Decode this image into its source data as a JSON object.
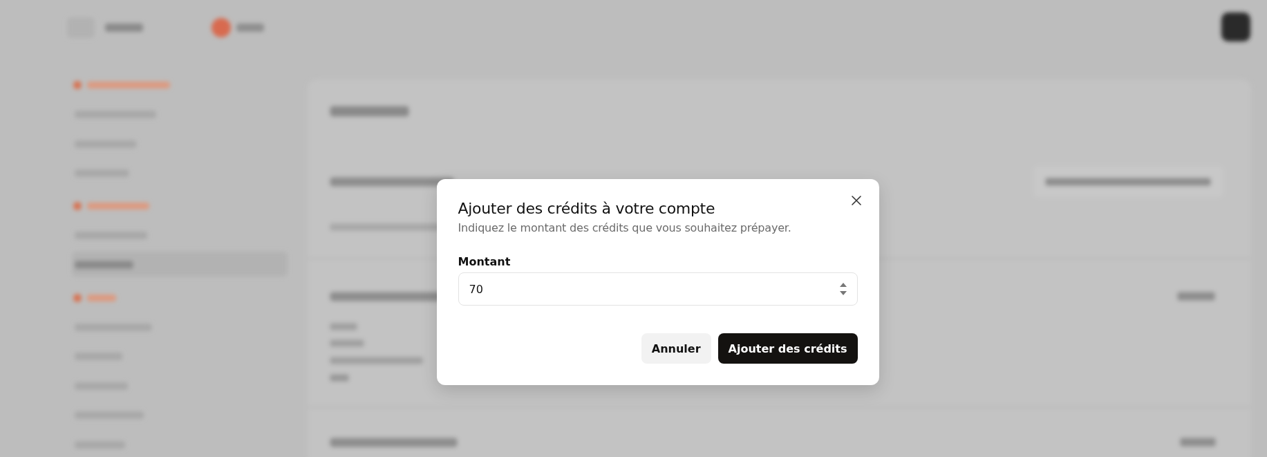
{
  "background": {
    "blurred": true
  },
  "dialog": {
    "title": "Ajouter des crédits à votre compte",
    "description": "Indiquez le montant des crédits que vous souhaitez prépayer.",
    "field": {
      "label": "Montant",
      "value": "70"
    },
    "buttons": [
      {
        "label": "Annuler",
        "kind": "secondary"
      },
      {
        "label": "Ajouter des crédits",
        "kind": "primary"
      }
    ]
  }
}
